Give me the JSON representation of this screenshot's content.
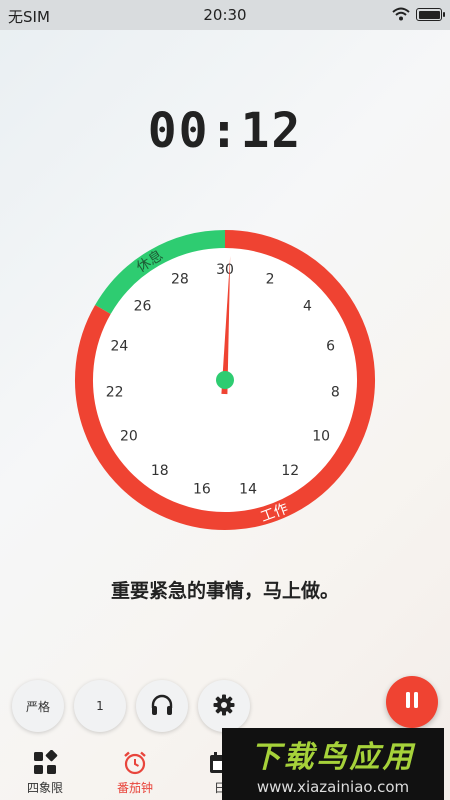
{
  "status_bar": {
    "carrier": "无SIM",
    "time": "20:30",
    "wifi_icon": "wifi-icon",
    "battery_icon": "battery-icon"
  },
  "timer": {
    "display": "00:12"
  },
  "dial": {
    "numbers": [
      "30",
      "2",
      "4",
      "6",
      "8",
      "10",
      "12",
      "14",
      "16",
      "18",
      "20",
      "22",
      "24",
      "26",
      "28"
    ],
    "segments": [
      {
        "label": "休息",
        "color": "#2ecc71",
        "start_minute": 25,
        "end_minute": 30
      },
      {
        "label": "工作",
        "color": "#ef4332",
        "start_minute": 0,
        "end_minute": 25
      }
    ],
    "hand_minute": 0.2,
    "work_color": "#ef4332",
    "rest_color": "#2ecc71"
  },
  "task": {
    "text": "重要紧急的事情，马上做。"
  },
  "controls": {
    "mode_label": "严格",
    "count_label": "1",
    "headphones_icon": "headphones-icon",
    "settings_icon": "gear-icon",
    "pause_icon": "pause-icon"
  },
  "tabs": [
    {
      "label": "四象限",
      "icon": "grid-icon",
      "active": false
    },
    {
      "label": "番茄钟",
      "icon": "alarm-clock-icon",
      "active": true
    },
    {
      "label": "日",
      "icon": "calendar-icon",
      "active": false
    }
  ],
  "watermark": {
    "title": "下载鸟应用",
    "url": "www.xiazainiao.com"
  }
}
